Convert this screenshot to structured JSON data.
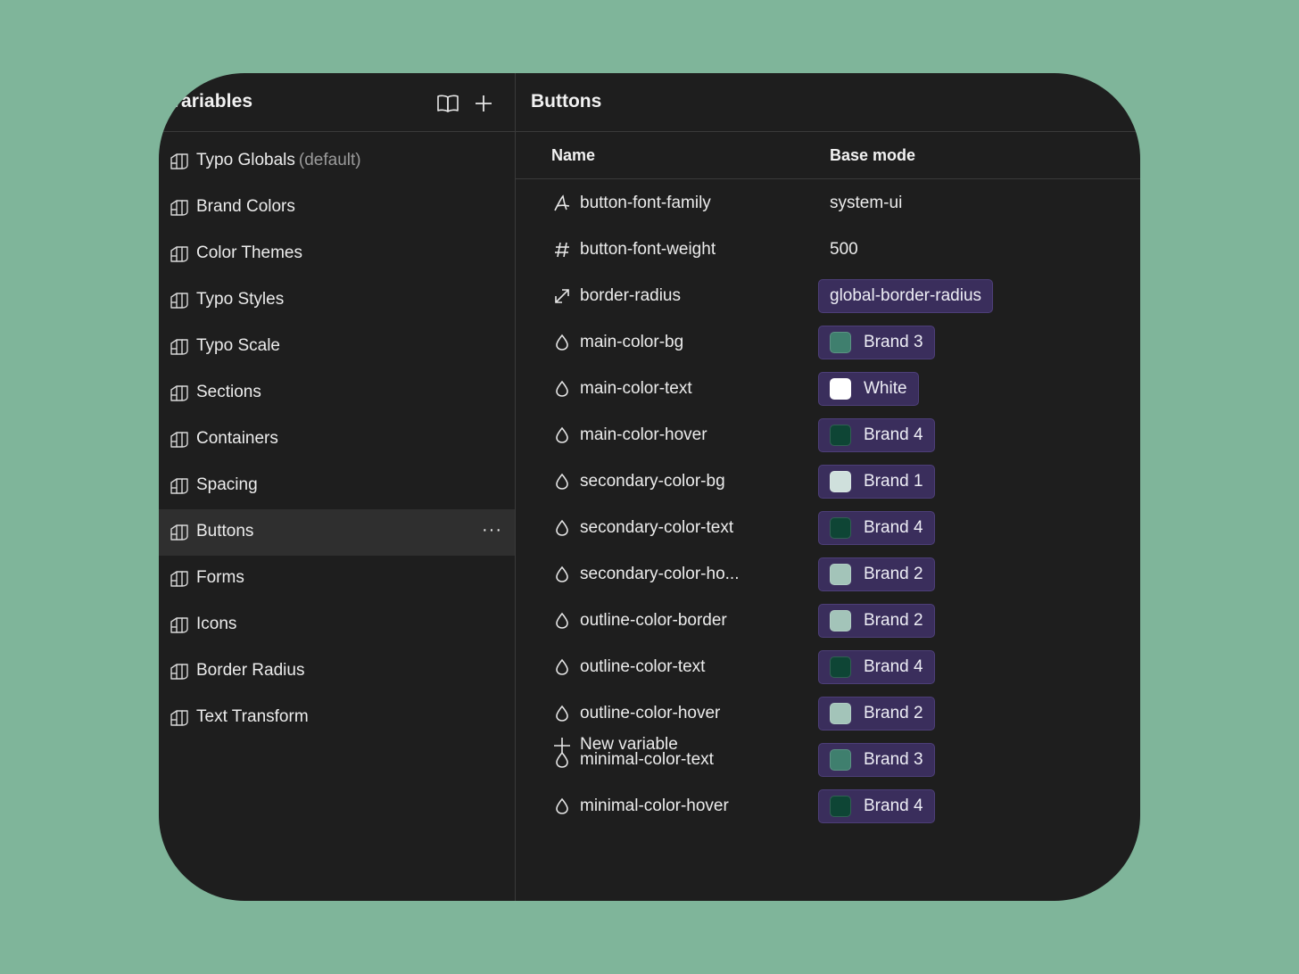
{
  "sidebar": {
    "title": "Variables",
    "collections": [
      {
        "label": "Typo Globals",
        "tag": "(default)"
      },
      {
        "label": "Brand Colors"
      },
      {
        "label": "Color Themes"
      },
      {
        "label": "Typo Styles"
      },
      {
        "label": "Typo Scale"
      },
      {
        "label": "Sections"
      },
      {
        "label": "Containers"
      },
      {
        "label": "Spacing"
      },
      {
        "label": "Buttons",
        "active": true
      },
      {
        "label": "Forms"
      },
      {
        "label": "Icons"
      },
      {
        "label": "Border Radius"
      },
      {
        "label": "Text Transform"
      }
    ],
    "more_glyph": "···"
  },
  "main": {
    "title": "Buttons",
    "columns": {
      "name": "Name",
      "mode": "Base mode"
    },
    "variables": [
      {
        "name": "button-font-family",
        "type": "font-icon",
        "value": "system-ui"
      },
      {
        "name": "button-font-weight",
        "type": "number-icon",
        "value": "500"
      },
      {
        "name": "border-radius",
        "type": "resize-icon",
        "value": "global-border-radius",
        "alias": true
      },
      {
        "name": "main-color-bg",
        "type": "drop-icon",
        "value": "Brand 3",
        "alias": true,
        "swatch": "#3f7f6e"
      },
      {
        "name": "main-color-text",
        "type": "drop-icon",
        "value": "White",
        "alias": true,
        "swatch": "#ffffff"
      },
      {
        "name": "main-color-hover",
        "type": "drop-icon",
        "value": "Brand 4",
        "alias": true,
        "swatch": "#0e4535"
      },
      {
        "name": "secondary-color-bg",
        "type": "drop-icon",
        "value": "Brand 1",
        "alias": true,
        "swatch": "#cfe0dc"
      },
      {
        "name": "secondary-color-text",
        "type": "drop-icon",
        "value": "Brand 4",
        "alias": true,
        "swatch": "#0e4535"
      },
      {
        "name": "secondary-color-ho...",
        "type": "drop-icon",
        "value": "Brand 2",
        "alias": true,
        "swatch": "#a3c4b9"
      },
      {
        "name": "outline-color-border",
        "type": "drop-icon",
        "value": "Brand 2",
        "alias": true,
        "swatch": "#a3c4b9"
      },
      {
        "name": "outline-color-text",
        "type": "drop-icon",
        "value": "Brand 4",
        "alias": true,
        "swatch": "#0e4535"
      },
      {
        "name": "outline-color-hover",
        "type": "drop-icon",
        "value": "Brand 2",
        "alias": true,
        "swatch": "#a3c4b9"
      },
      {
        "name": "minimal-color-text",
        "type": "drop-icon",
        "value": "Brand 3",
        "alias": true,
        "swatch": "#3f7f6e"
      },
      {
        "name": "minimal-color-hover",
        "type": "drop-icon",
        "value": "Brand 4",
        "alias": true,
        "swatch": "#0e4535"
      }
    ],
    "new_variable_label": "New variable"
  },
  "colors": {
    "background": "#7fb59a",
    "panel": "#1e1e1e",
    "active_row": "#2f2f2f",
    "alias_pill": "#3a2e5c"
  }
}
